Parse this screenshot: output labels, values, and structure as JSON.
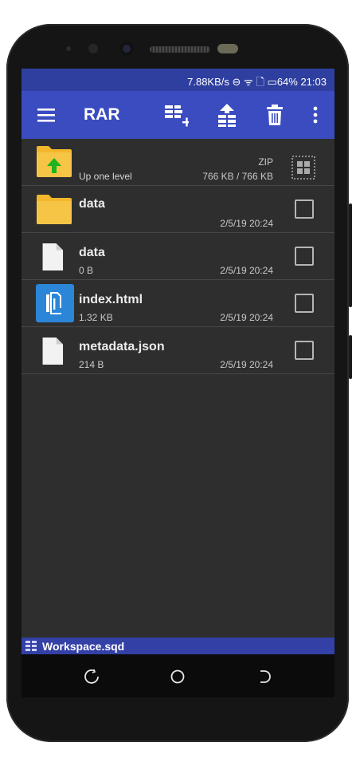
{
  "status_bar": {
    "text": "7.88KB/s ⊖ ᯤ 🗋 ▭64% 21:03"
  },
  "toolbar": {
    "title": "RAR",
    "icons": [
      "menu-icon",
      "add-to-archive-icon",
      "extract-icon",
      "delete-icon",
      "more-vert-icon"
    ]
  },
  "files": {
    "up": {
      "name": "Up one level",
      "type": "ZIP",
      "size": "766 KB / 766 KB"
    },
    "items": [
      {
        "name": "data",
        "size": "",
        "date": "2/5/19 20:24",
        "icon": "folder-icon"
      },
      {
        "name": "data",
        "size": "0 B",
        "date": "2/5/19 20:24",
        "icon": "file-icon"
      },
      {
        "name": "index.html",
        "size": "1.32 KB",
        "date": "2/5/19 20:24",
        "icon": "html-file-icon"
      },
      {
        "name": "metadata.json",
        "size": "214 B",
        "date": "2/5/19 20:24",
        "icon": "file-icon"
      }
    ]
  },
  "workspace": {
    "label": "Workspace.sqd"
  },
  "colors": {
    "toolbar": "#3a4cc0",
    "statusbar": "#2f3fa0",
    "background": "#2e2e2e",
    "folder": "#f4b72b",
    "up_arrow": "#1fb31f",
    "html_icon": "#2c86d8"
  }
}
